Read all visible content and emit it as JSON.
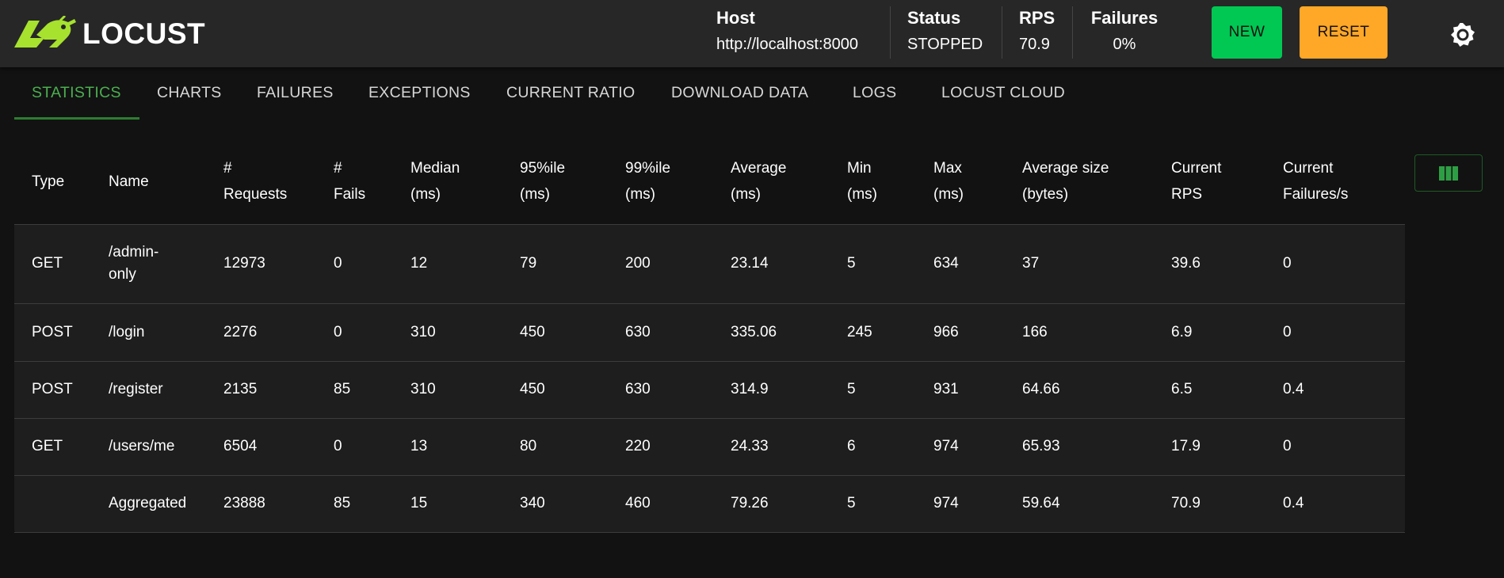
{
  "app": {
    "name": "LOCUST"
  },
  "header": {
    "host": {
      "label": "Host",
      "value": "http://localhost:8000"
    },
    "status": {
      "label": "Status",
      "value": "STOPPED"
    },
    "rps": {
      "label": "RPS",
      "value": "70.9"
    },
    "failures": {
      "label": "Failures",
      "value": "0%"
    },
    "new_label": "NEW",
    "reset_label": "RESET",
    "theme_icon": "sun-icon"
  },
  "tabs": [
    {
      "label": "STATISTICS",
      "active": true
    },
    {
      "label": "CHARTS"
    },
    {
      "label": "FAILURES"
    },
    {
      "label": "EXCEPTIONS"
    },
    {
      "label": "CURRENT RATIO"
    },
    {
      "label": "DOWNLOAD DATA"
    },
    {
      "label": "LOGS"
    },
    {
      "label": "LOCUST CLOUD"
    }
  ],
  "table": {
    "columns": [
      [
        "Type"
      ],
      [
        "Name"
      ],
      [
        "#",
        "Requests"
      ],
      [
        "#",
        "Fails"
      ],
      [
        "Median",
        "(ms)"
      ],
      [
        "95%ile",
        "(ms)"
      ],
      [
        "99%ile",
        "(ms)"
      ],
      [
        "Average",
        "(ms)"
      ],
      [
        "Min",
        "(ms)"
      ],
      [
        "Max",
        "(ms)"
      ],
      [
        "Average size",
        "(bytes)"
      ],
      [
        "Current",
        "RPS"
      ],
      [
        "Current",
        "Failures/s"
      ]
    ],
    "rows": [
      [
        "GET",
        "/admin-only",
        "12973",
        "0",
        "12",
        "79",
        "200",
        "23.14",
        "5",
        "634",
        "37",
        "39.6",
        "0"
      ],
      [
        "POST",
        "/login",
        "2276",
        "0",
        "310",
        "450",
        "630",
        "335.06",
        "245",
        "966",
        "166",
        "6.9",
        "0"
      ],
      [
        "POST",
        "/register",
        "2135",
        "85",
        "310",
        "450",
        "630",
        "314.9",
        "5",
        "931",
        "64.66",
        "6.5",
        "0.4"
      ],
      [
        "GET",
        "/users/me",
        "6504",
        "0",
        "13",
        "80",
        "220",
        "24.33",
        "6",
        "974",
        "65.93",
        "17.9",
        "0"
      ],
      [
        "",
        "Aggregated",
        "23888",
        "85",
        "15",
        "340",
        "460",
        "79.26",
        "5",
        "974",
        "59.64",
        "70.9",
        "0.4"
      ]
    ]
  },
  "colors": {
    "accent_green": "#4caf50",
    "new_button": "#00c853",
    "reset_button": "#ffa726",
    "logo_green": "#a6e22e"
  }
}
